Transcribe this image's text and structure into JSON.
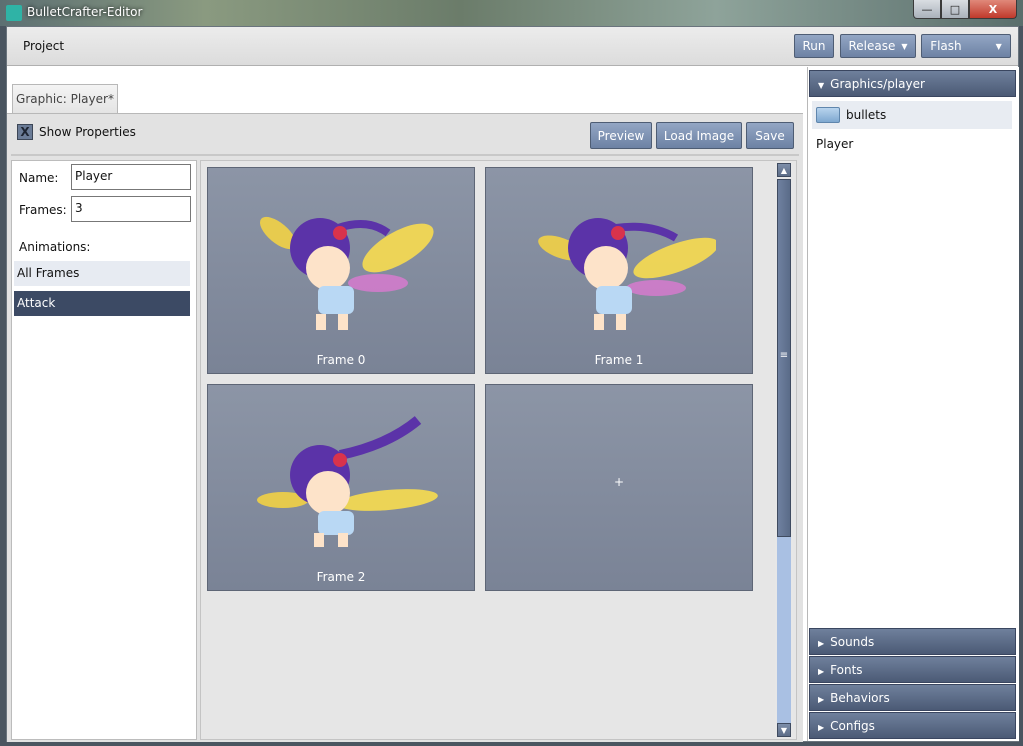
{
  "window": {
    "title": "BulletCrafter-Editor",
    "min": "—",
    "max": "□",
    "close": "X"
  },
  "toolbar": {
    "project_label": "Project",
    "run_label": "Run",
    "release_label": "Release",
    "flash_label": "Flash",
    "caret": "▼"
  },
  "editor": {
    "tab_label": "Graphic: Player*",
    "show_properties_label": "Show Properties",
    "show_properties_checked": true,
    "checkbox_mark": "X",
    "preview_label": "Preview",
    "load_image_label": "Load Image",
    "save_label": "Save"
  },
  "properties": {
    "name_label": "Name:",
    "name_value": "Player",
    "frames_label": "Frames:",
    "frames_value": "3",
    "animations_label": "Animations:",
    "animations": [
      {
        "label": "All Frames",
        "selected": false
      },
      {
        "label": "Attack",
        "selected": true
      }
    ]
  },
  "frames": [
    {
      "label": "Frame 0"
    },
    {
      "label": "Frame 1"
    },
    {
      "label": "Frame 2"
    },
    {
      "label": "+"
    }
  ],
  "scrollbar": {
    "up": "▲",
    "down": "▼",
    "grip": "≡"
  },
  "sidebar": {
    "graphics_header": "Graphics/player",
    "expanded_arrow": "▼",
    "collapsed_arrow": "▶",
    "items": [
      {
        "type": "folder",
        "label": "bullets"
      },
      {
        "type": "file",
        "label": "Player"
      }
    ],
    "sections": [
      "Sounds",
      "Fonts",
      "Behaviors",
      "Configs"
    ]
  },
  "colors": {
    "accent": "#6d82a4",
    "selected_row": "#3c4a64",
    "frame_cell": "#838c9e",
    "scroll_track": "#a9c0e3"
  }
}
